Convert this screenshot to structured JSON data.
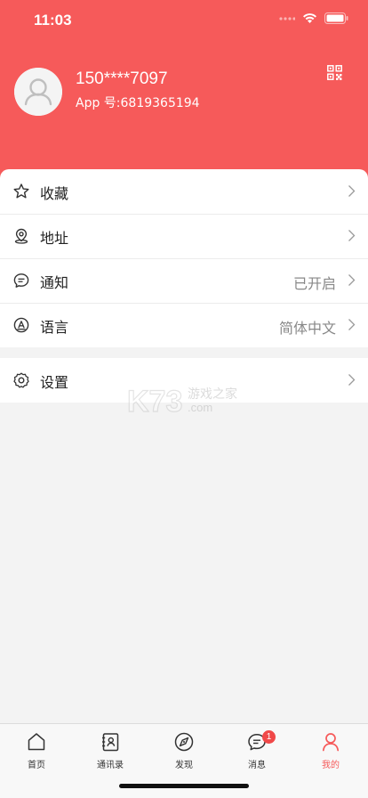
{
  "status_bar": {
    "time": "11:03"
  },
  "profile": {
    "phone": "150****7097",
    "app_id": "App 号:6819365194"
  },
  "menu": {
    "items": [
      {
        "label": "收藏",
        "value": ""
      },
      {
        "label": "地址",
        "value": ""
      },
      {
        "label": "通知",
        "value": "已开启"
      },
      {
        "label": "语言",
        "value": "简体中文"
      }
    ],
    "settings": {
      "label": "设置"
    }
  },
  "watermark": {
    "brand": "K73",
    "tagline": "游戏之家",
    "domain": ".com"
  },
  "tabbar": {
    "tabs": [
      {
        "label": "首页"
      },
      {
        "label": "通讯录"
      },
      {
        "label": "发现"
      },
      {
        "label": "消息",
        "badge": "1"
      },
      {
        "label": "我的"
      }
    ],
    "active_index": 4
  },
  "colors": {
    "brand": "#f65a5a",
    "badge": "#f04848"
  }
}
